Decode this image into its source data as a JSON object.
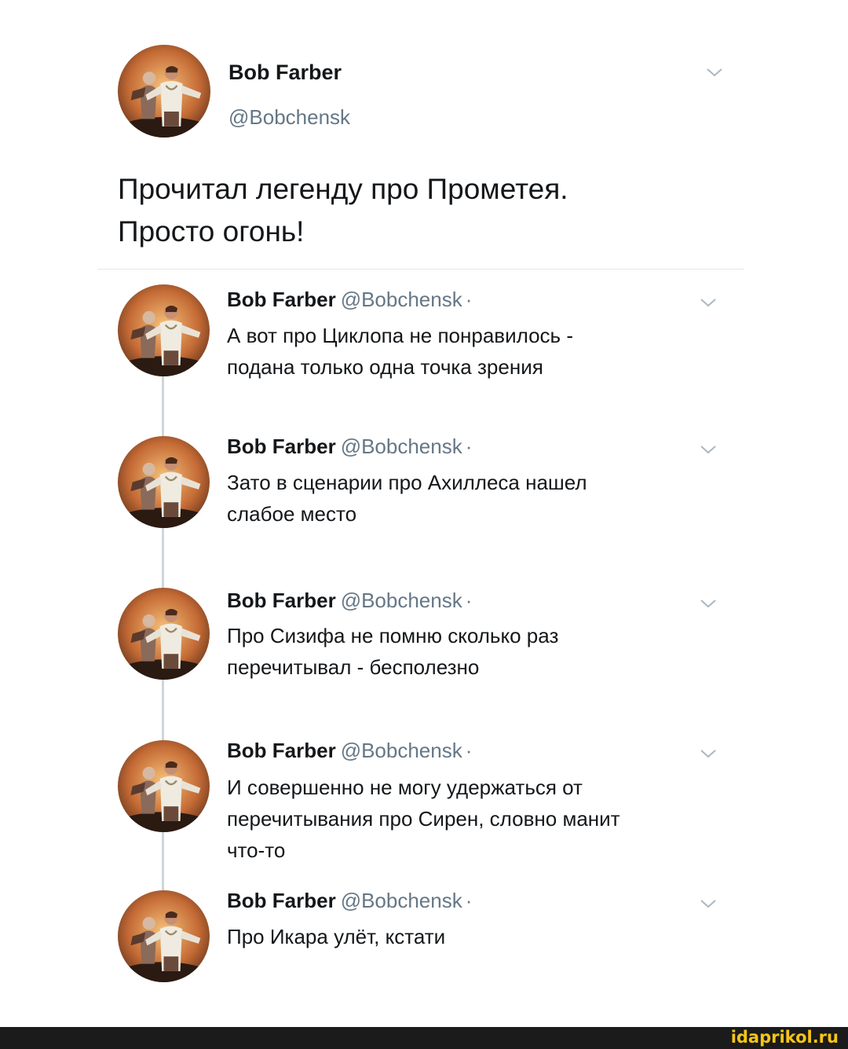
{
  "main_tweet": {
    "name": "Bob Farber",
    "handle": "@Bobchensk",
    "text_line1": "Прочитал легенду про Прометея.",
    "text_line2": "Просто огонь!",
    "avatar_icon": "avatar-photo",
    "menu_icon": "chevron-down-icon"
  },
  "replies": [
    {
      "name": "Bob Farber",
      "handle": "@Bobchensk",
      "dot": "·",
      "lines": [
        "А вот про Циклопа не понравилось -",
        "подана только одна точка зрения"
      ]
    },
    {
      "name": "Bob Farber",
      "handle": "@Bobchensk",
      "dot": "·",
      "lines": [
        "Зато в сценарии про Ахиллеса нашел",
        "слабое место"
      ]
    },
    {
      "name": "Bob Farber",
      "handle": "@Bobchensk",
      "dot": "·",
      "lines": [
        "Про Сизифа не помню сколько раз",
        "перечитывал - бесполезно"
      ]
    },
    {
      "name": "Bob Farber",
      "handle": "@Bobchensk",
      "dot": "·",
      "lines": [
        "И совершенно не могу удержаться от",
        "перечитывания про Сирен, словно манит",
        "что-то"
      ]
    },
    {
      "name": "Bob Farber",
      "handle": "@Bobchensk",
      "dot": "·",
      "lines": [
        "Про Икара улёт, кстати"
      ]
    }
  ],
  "footer": {
    "watermark": "idaprikol.ru"
  },
  "colors": {
    "text": "#14171a",
    "secondary": "#657786",
    "thread_line": "#ccd6dd",
    "watermark": "#f5c518"
  }
}
